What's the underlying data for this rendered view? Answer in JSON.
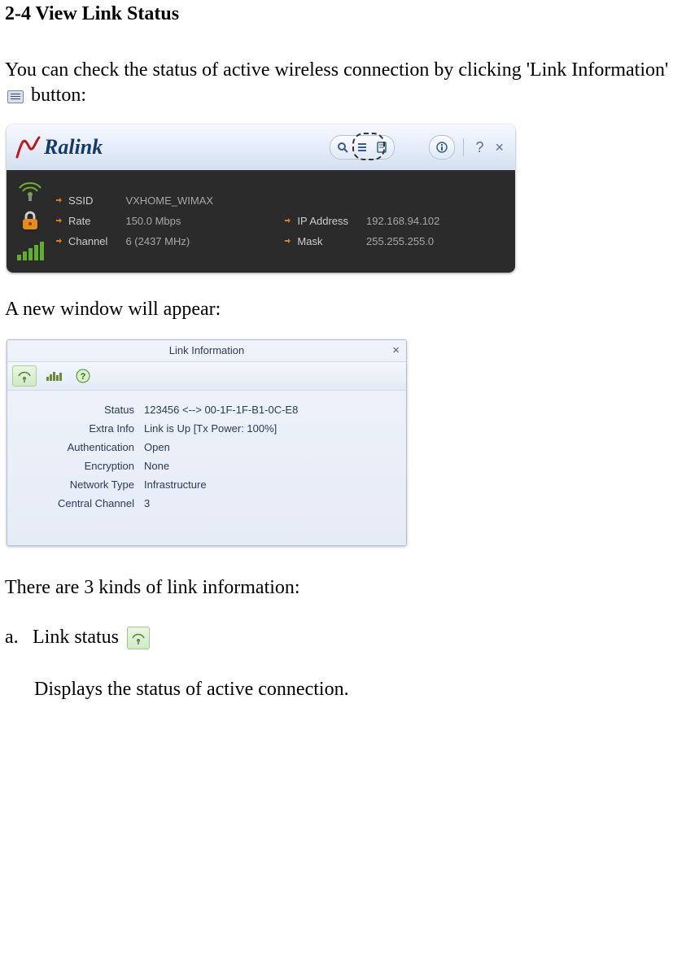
{
  "section_title": "2-4 View Link Status",
  "intro_text_before": "You can check the status of active wireless connection by clicking 'Link Information' ",
  "intro_text_after": " button:",
  "ralink": {
    "logo_text": "Ralink",
    "fields": {
      "ssid_label": "SSID",
      "ssid_value": "VXHOME_WIMAX",
      "rate_label": "Rate",
      "rate_value": "150.0 Mbps",
      "channel_label": "Channel",
      "channel_value": "6 (2437 MHz)",
      "ip_label": "IP Address",
      "ip_value": "192.168.94.102",
      "mask_label": "Mask",
      "mask_value": "255.255.255.0"
    }
  },
  "new_window_text": "A new window will appear:",
  "linkinfo": {
    "title": "Link Information",
    "rows": {
      "status_label": "Status",
      "status_value": "123456 <--> 00-1F-1F-B1-0C-E8",
      "extra_label": "Extra Info",
      "extra_value": "Link is Up  [Tx Power: 100%]",
      "auth_label": "Authentication",
      "auth_value": "Open",
      "enc_label": "Encryption",
      "enc_value": "None",
      "net_label": "Network Type",
      "net_value": "Infrastructure",
      "chan_label": "Central Channel",
      "chan_value": "3"
    }
  },
  "kinds_text": "There are 3 kinds of link information:",
  "item_a_marker": "a.",
  "item_a_text": "Link status ",
  "item_a_desc": "Displays the status of active connection."
}
